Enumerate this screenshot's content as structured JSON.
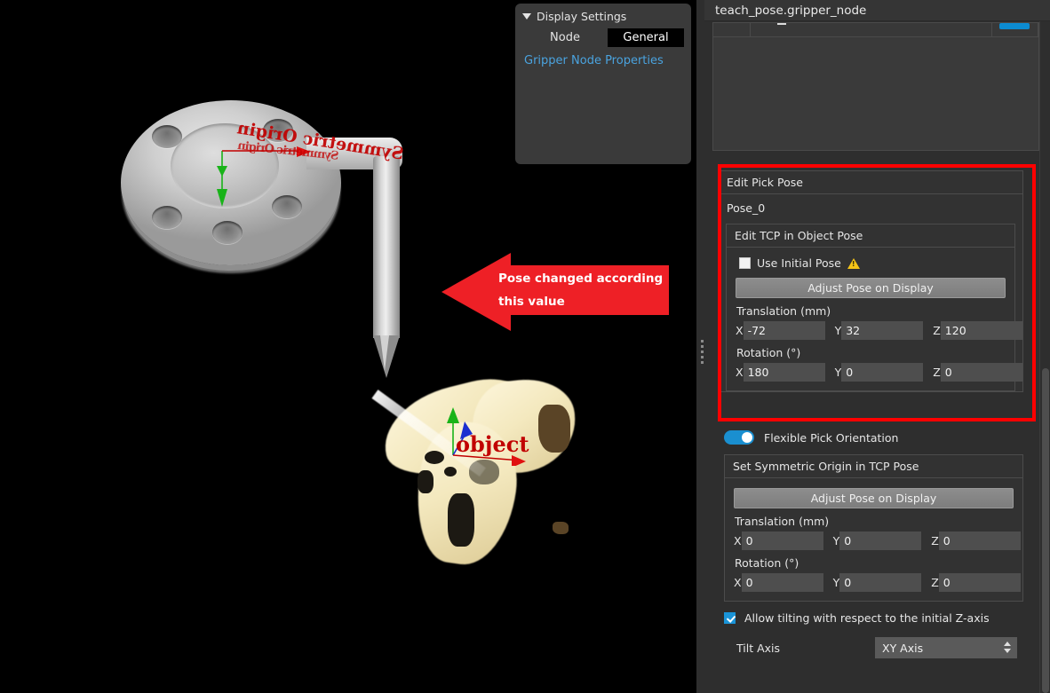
{
  "viewport": {
    "labels": {
      "symmetric_origin": "Symmetric Origin",
      "object": "object"
    },
    "annotation": {
      "line1": "Pose changed according",
      "line2": "this value",
      "color": "#ee2026",
      "direction": "left"
    }
  },
  "display_settings": {
    "title": "Display Settings",
    "node_label": "Node",
    "node_value": "General",
    "link": "Gripper Node Properties"
  },
  "right_panel": {
    "title": "teach_pose.gripper_node",
    "edit_pick_pose": {
      "header": "Edit Pick Pose",
      "pose_name": "Pose_0",
      "tcp_group_title": "Edit TCP in Object Pose",
      "use_initial_pose_label": "Use Initial Pose",
      "use_initial_pose_checked": false,
      "warning_icon": "warning-triangle-icon",
      "adjust_button": "Adjust Pose on Display",
      "translation_label": "Translation (mm)",
      "translation": {
        "x": "-72",
        "y": "32",
        "z": "120"
      },
      "rotation_label": "Rotation (°)",
      "rotation": {
        "x": "180",
        "y": "0",
        "z": "0"
      },
      "axis_labels": {
        "x": "X",
        "y": "Y",
        "z": "Z"
      },
      "highlight_color": "#ff0000"
    },
    "flexible_pick": {
      "toggle_label": "Flexible Pick Orientation",
      "toggle_on": true,
      "group_title": "Set Symmetric Origin in TCP Pose",
      "adjust_button": "Adjust Pose on Display",
      "translation_label": "Translation (mm)",
      "translation": {
        "x": "0",
        "y": "0",
        "z": "0"
      },
      "rotation_label": "Rotation (°)",
      "rotation": {
        "x": "0",
        "y": "0",
        "z": "0"
      },
      "axis_labels": {
        "x": "X",
        "y": "Y",
        "z": "Z"
      },
      "allow_tilting_label": "Allow tilting with respect to the initial Z-axis",
      "allow_tilting_checked": true,
      "tilt_axis_label": "Tilt Axis",
      "tilt_axis_value": "XY Axis"
    }
  }
}
